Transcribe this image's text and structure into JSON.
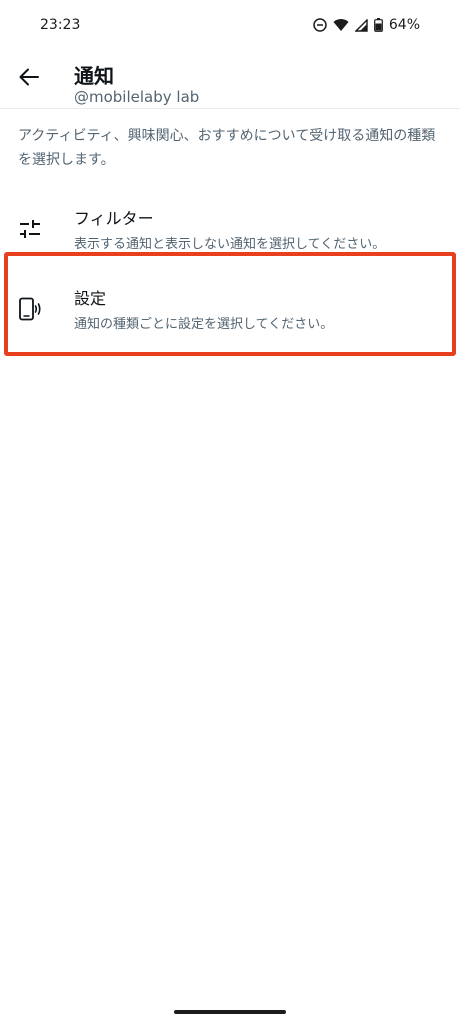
{
  "status_bar": {
    "time": "23:23",
    "battery": "64%",
    "icons": [
      "do-not-disturb-icon",
      "wifi-icon",
      "cell-signal-icon",
      "battery-icon"
    ]
  },
  "header": {
    "title": "通知",
    "subtitle": "@mobilelaby lab"
  },
  "description": "アクティビティ、興味関心、おすすめについて受け取る通知の種類を選択します。",
  "items": [
    {
      "icon": "sliders-icon",
      "title": "フィルター",
      "subtitle": "表示する通知と表示しない通知を選択してください。"
    },
    {
      "icon": "phone-vibrate-icon",
      "title": "設定",
      "subtitle": "通知の種類ごとに設定を選択してください。"
    }
  ],
  "colors": {
    "highlight": "#e8401f",
    "text_primary": "#0f1419",
    "text_secondary": "#536471"
  }
}
